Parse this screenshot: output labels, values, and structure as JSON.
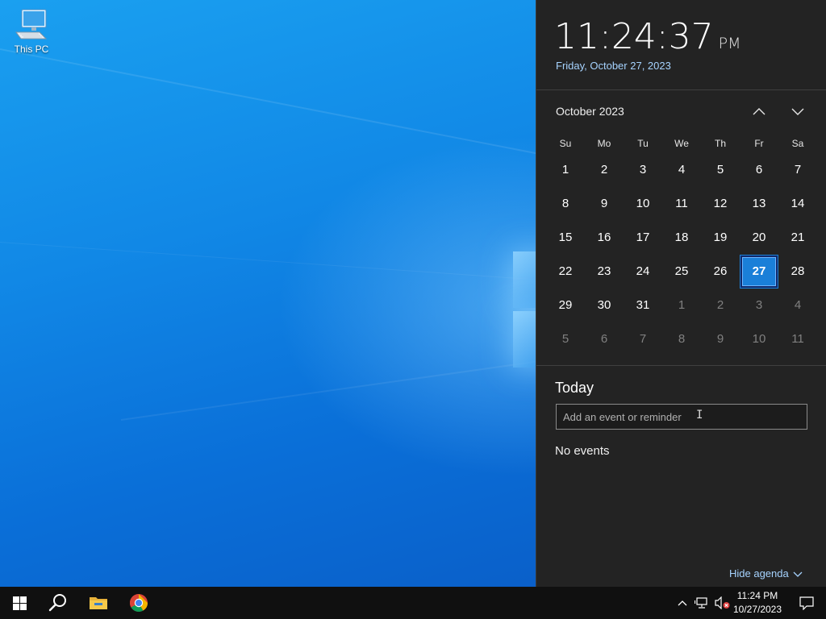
{
  "desktop": {
    "icons": [
      {
        "label": "This PC",
        "icon": "computer-icon"
      }
    ]
  },
  "flyout": {
    "time": "11:24:37",
    "ampm": "PM",
    "date_long": "Friday, October 27, 2023",
    "calendar": {
      "month_title": "October 2023",
      "weekdays": [
        "Su",
        "Mo",
        "Tu",
        "We",
        "Th",
        "Fr",
        "Sa"
      ],
      "weeks": [
        [
          {
            "d": "1",
            "c": true
          },
          {
            "d": "2",
            "c": true
          },
          {
            "d": "3",
            "c": true
          },
          {
            "d": "4",
            "c": true
          },
          {
            "d": "5",
            "c": true
          },
          {
            "d": "6",
            "c": true
          },
          {
            "d": "7",
            "c": true
          }
        ],
        [
          {
            "d": "8",
            "c": true
          },
          {
            "d": "9",
            "c": true
          },
          {
            "d": "10",
            "c": true
          },
          {
            "d": "11",
            "c": true
          },
          {
            "d": "12",
            "c": true
          },
          {
            "d": "13",
            "c": true
          },
          {
            "d": "14",
            "c": true
          }
        ],
        [
          {
            "d": "15",
            "c": true
          },
          {
            "d": "16",
            "c": true
          },
          {
            "d": "17",
            "c": true
          },
          {
            "d": "18",
            "c": true
          },
          {
            "d": "19",
            "c": true
          },
          {
            "d": "20",
            "c": true
          },
          {
            "d": "21",
            "c": true
          }
        ],
        [
          {
            "d": "22",
            "c": true
          },
          {
            "d": "23",
            "c": true
          },
          {
            "d": "24",
            "c": true
          },
          {
            "d": "25",
            "c": true
          },
          {
            "d": "26",
            "c": true
          },
          {
            "d": "27",
            "c": true,
            "today": true
          },
          {
            "d": "28",
            "c": true
          }
        ],
        [
          {
            "d": "29",
            "c": true
          },
          {
            "d": "30",
            "c": true
          },
          {
            "d": "31",
            "c": true
          },
          {
            "d": "1",
            "c": false
          },
          {
            "d": "2",
            "c": false
          },
          {
            "d": "3",
            "c": false
          },
          {
            "d": "4",
            "c": false
          }
        ],
        [
          {
            "d": "5",
            "c": false
          },
          {
            "d": "6",
            "c": false
          },
          {
            "d": "7",
            "c": false
          },
          {
            "d": "8",
            "c": false
          },
          {
            "d": "9",
            "c": false
          },
          {
            "d": "10",
            "c": false
          },
          {
            "d": "11",
            "c": false
          }
        ]
      ]
    },
    "agenda": {
      "title": "Today",
      "input_placeholder": "Add an event or reminder",
      "input_value": "",
      "empty_text": "No events",
      "hide_label": "Hide agenda"
    }
  },
  "taskbar": {
    "pinned": [
      {
        "name": "start-button",
        "icon": "windows-logo-icon"
      },
      {
        "name": "search-button",
        "icon": "search-icon"
      },
      {
        "name": "file-explorer-button",
        "icon": "folder-icon"
      },
      {
        "name": "chrome-button",
        "icon": "chrome-icon"
      }
    ],
    "tray": {
      "icons": [
        "chevron-up-icon",
        "network-icon",
        "volume-muted-icon",
        "action-center-icon"
      ],
      "time": "11:24 PM",
      "date": "10/27/2023"
    }
  },
  "colors": {
    "accent": "#1a7fd8",
    "flyout_bg": "#232323",
    "link": "#a6d3ff",
    "taskbar_bg": "#101010"
  }
}
